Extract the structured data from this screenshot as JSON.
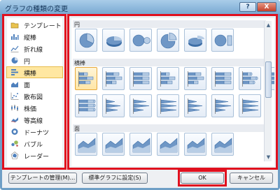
{
  "window": {
    "title": "グラフの種類の変更",
    "help_label": "?",
    "close_label": "X"
  },
  "categories": [
    {
      "label": "テンプレート",
      "icon": "folder-icon",
      "selected": false
    },
    {
      "label": "縦棒",
      "icon": "column-chart-icon",
      "selected": false
    },
    {
      "label": "折れ線",
      "icon": "line-chart-icon",
      "selected": false
    },
    {
      "label": "円",
      "icon": "pie-chart-icon",
      "selected": false
    },
    {
      "label": "横棒",
      "icon": "bar-chart-icon",
      "selected": true
    },
    {
      "label": "面",
      "icon": "area-chart-icon",
      "selected": false
    },
    {
      "label": "散布図",
      "icon": "scatter-chart-icon",
      "selected": false
    },
    {
      "label": "株価",
      "icon": "stock-chart-icon",
      "selected": false
    },
    {
      "label": "等高線",
      "icon": "surface-chart-icon",
      "selected": false
    },
    {
      "label": "ドーナツ",
      "icon": "doughnut-chart-icon",
      "selected": false
    },
    {
      "label": "バブル",
      "icon": "bubble-chart-icon",
      "selected": false
    },
    {
      "label": "レーダー",
      "icon": "radar-chart-icon",
      "selected": false
    }
  ],
  "gallery": {
    "sections": [
      {
        "label": "円",
        "thumbs": [
          "pie",
          "pie-3d",
          "pie-of-pie",
          "exploded-pie",
          "exploded-pie-3d",
          "bar-of-pie"
        ]
      },
      {
        "label": "横棒",
        "selected_index": 0,
        "thumbs": [
          "clustered-bar",
          "stacked-bar",
          "stacked-bar-100",
          "clustered-bar-3d",
          "stacked-bar-3d",
          "stacked-bar-100-3d",
          "clustered-cylinder",
          "stacked-cylinder",
          "stacked-cylinder-100",
          "clustered-cone",
          "stacked-cone",
          "stacked-cone-100",
          "clustered-pyramid",
          "stacked-pyramid",
          "stacked-pyramid-100"
        ]
      },
      {
        "label": "面",
        "thumbs": [
          "area",
          "stacked-area",
          "stacked-area-100",
          "area-3d",
          "stacked-area-3d",
          "stacked-area-100-3d"
        ]
      }
    ]
  },
  "buttons": {
    "manage_templates": "テンプレートの管理(M)...",
    "set_default": "標準グラフに設定(S)",
    "ok": "OK",
    "cancel": "キャンセル"
  },
  "colors": {
    "highlight_red": "#e0101e",
    "selection_fill": "#ffe7a1",
    "chart_blue": "#4f81bd"
  }
}
